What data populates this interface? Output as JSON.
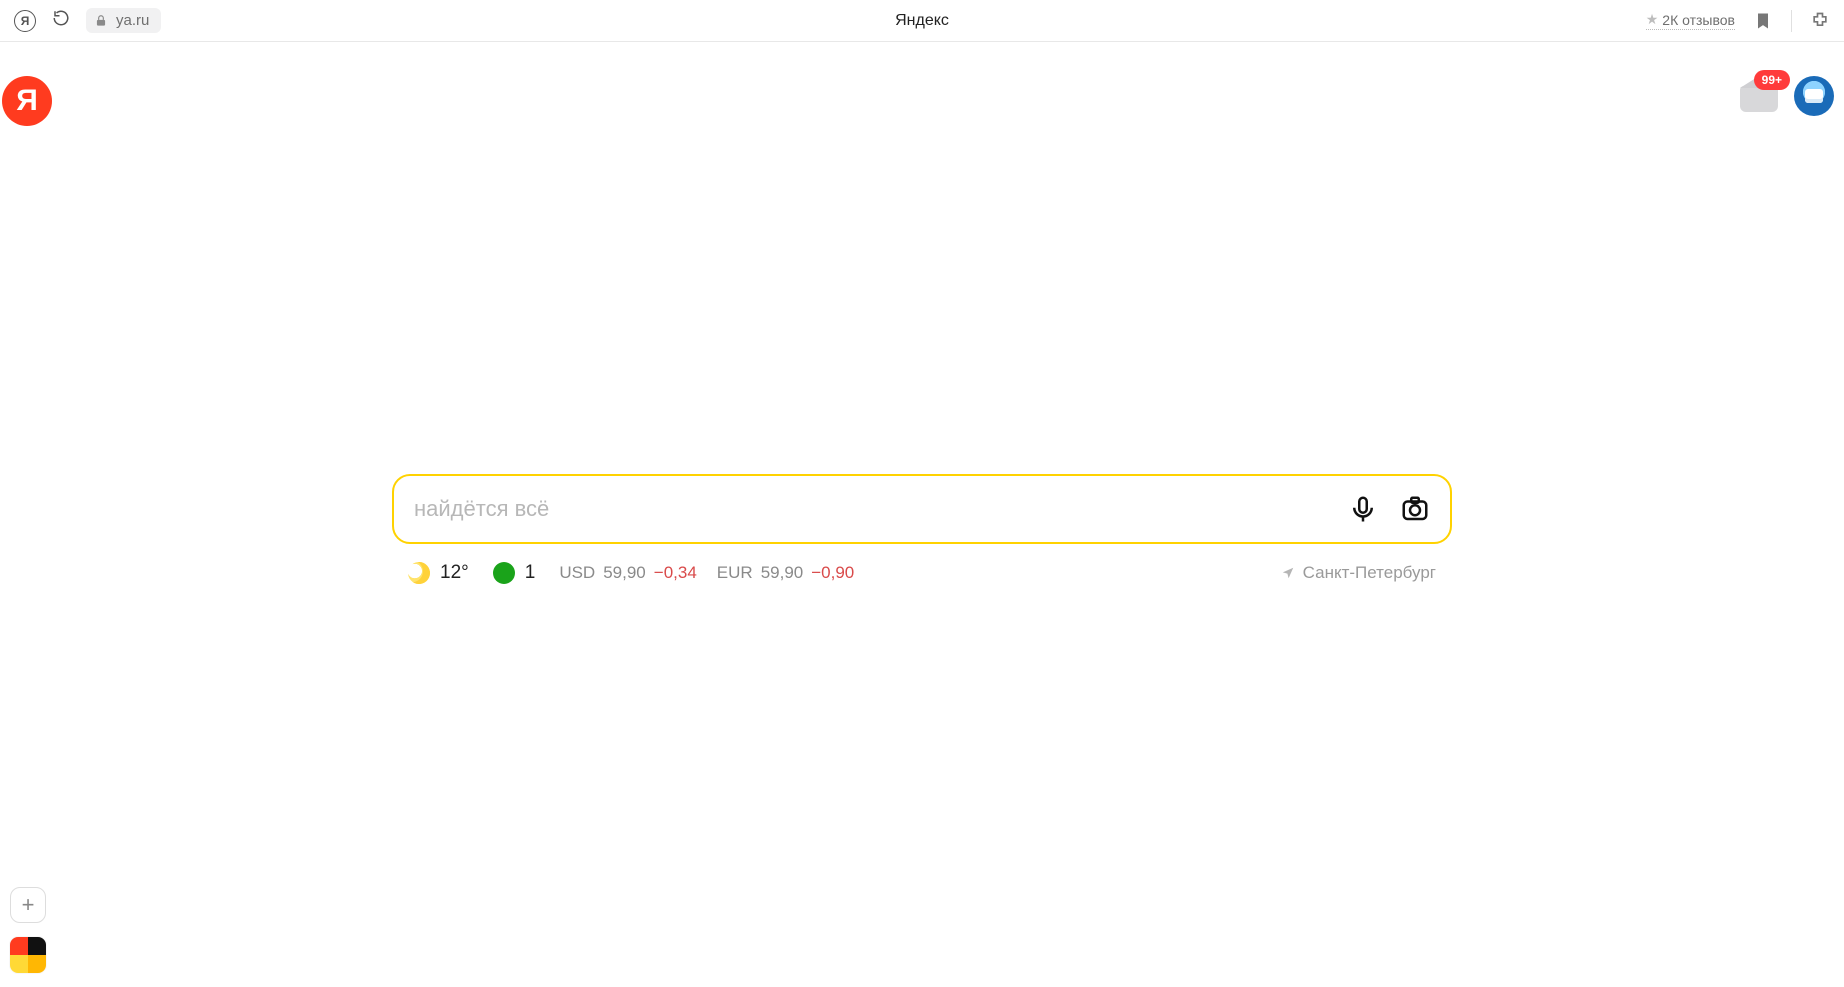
{
  "chrome": {
    "url": "ya.ru",
    "title": "Яндекс",
    "reviews_label": "2К отзывов"
  },
  "logo_letter": "Я",
  "mail": {
    "badge": "99+"
  },
  "search": {
    "placeholder": "найдётся всё"
  },
  "info": {
    "weather_temp": "12°",
    "traffic_level": "1",
    "rates": [
      {
        "code": "USD",
        "value": "59,90",
        "delta": "−0,34"
      },
      {
        "code": "EUR",
        "value": "59,90",
        "delta": "−0,90"
      }
    ],
    "geo": "Санкт-Петербург"
  }
}
